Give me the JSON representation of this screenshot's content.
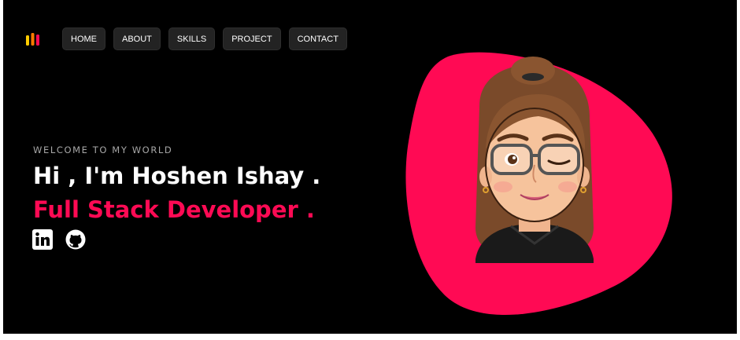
{
  "nav": {
    "items": [
      {
        "label": "HOME"
      },
      {
        "label": "ABOUT"
      },
      {
        "label": "SKILLS"
      },
      {
        "label": "PROJECT"
      },
      {
        "label": "CONTACT"
      }
    ]
  },
  "hero": {
    "welcome": "WELCOME TO MY WORLD",
    "headline": "Hi , I'm Hoshen Ishay .",
    "role": "Full Stack Developer ."
  },
  "socials": [
    {
      "icon": "linkedin-icon"
    },
    {
      "icon": "github-icon"
    }
  ],
  "colors": {
    "background": "#000000",
    "accent": "#ff0a54",
    "nav_button": "#232323",
    "logo_bars": [
      "#ffcc00",
      "#ff7a00",
      "#ff0a54"
    ]
  }
}
